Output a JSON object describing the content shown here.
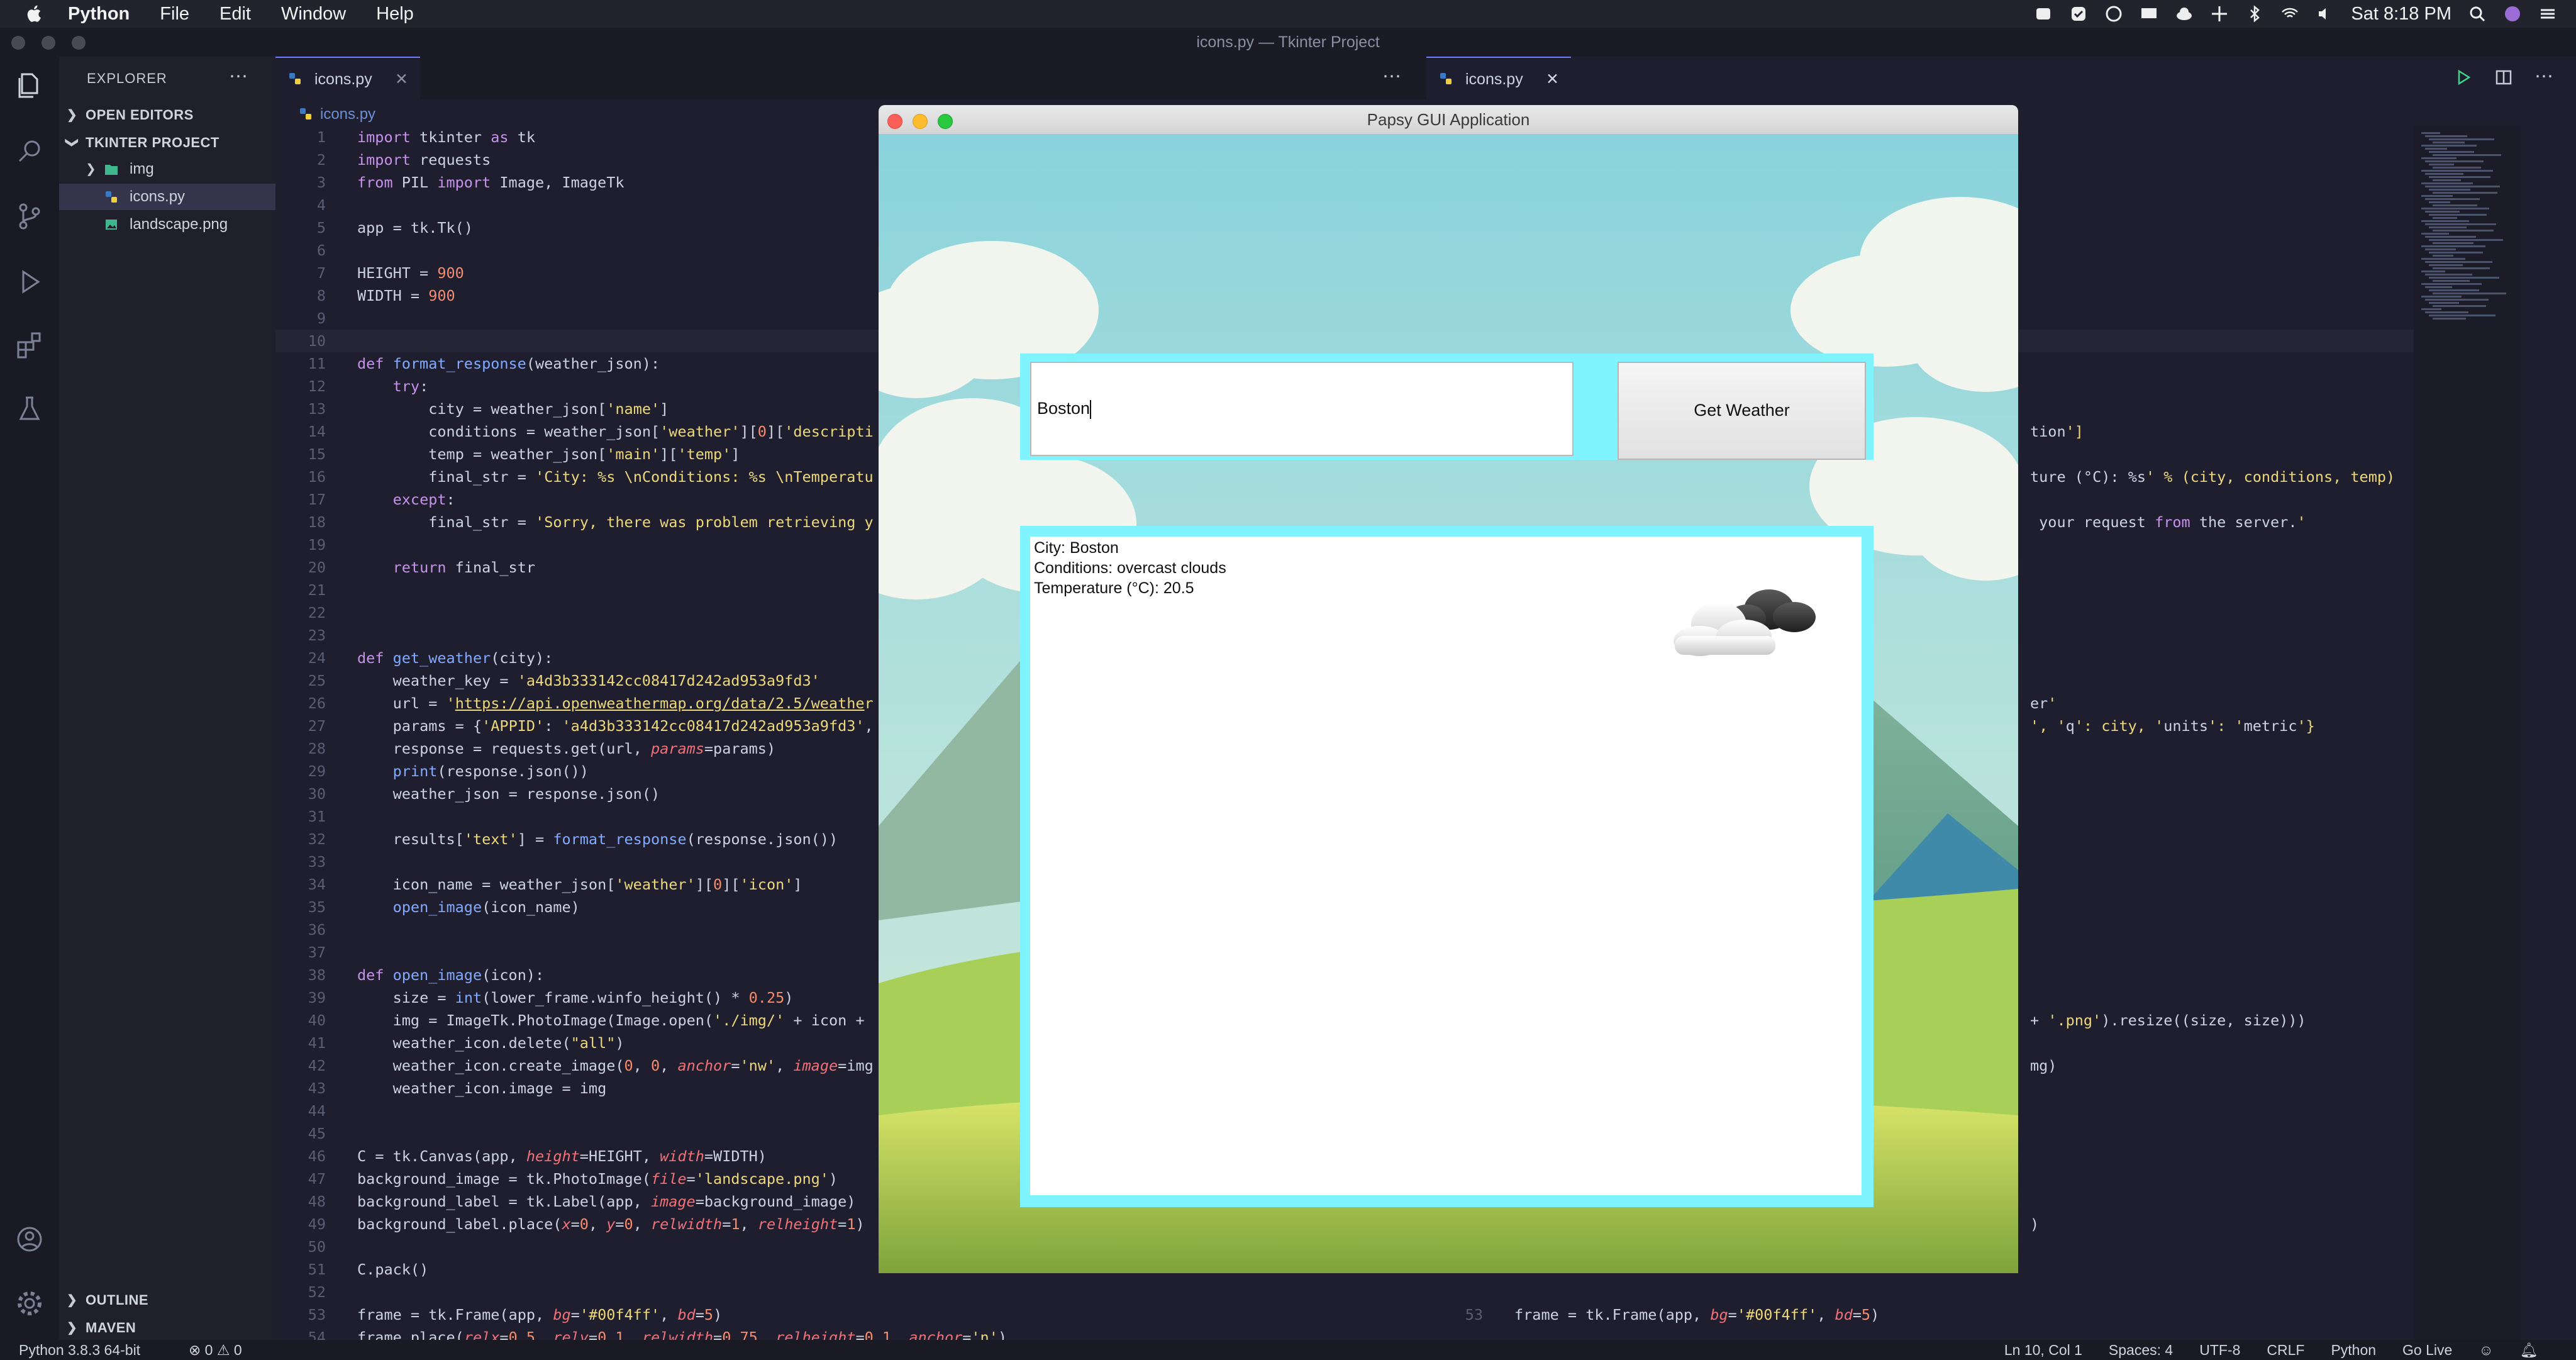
{
  "menubar": {
    "app": "Python",
    "items": [
      "File",
      "Edit",
      "Window",
      "Help"
    ],
    "clock": "Sat 8:18 PM"
  },
  "window_title": "icons.py — Tkinter Project",
  "sidebar": {
    "header": "EXPLORER",
    "open_editors": "OPEN EDITORS",
    "project": "TKINTER PROJECT",
    "files": [
      "img",
      "icons.py",
      "landscape.png"
    ],
    "outline": "OUTLINE",
    "maven": "MAVEN"
  },
  "editor": {
    "tab_left": "icons.py",
    "tab_right": "icons.py",
    "breadcrumb": "icons.py"
  },
  "code_lines": [
    "import tkinter as tk",
    "import requests",
    "from PIL import Image, ImageTk",
    "",
    "app = tk.Tk()",
    "",
    "HEIGHT = 900",
    "WIDTH = 900",
    "",
    "",
    "def format_response(weather_json):",
    "    try:",
    "        city = weather_json['name']",
    "        conditions = weather_json['weather'][0]['descripti",
    "        temp = weather_json['main']['temp']",
    "        final_str = 'City: %s \\nConditions: %s \\nTemperatu",
    "    except:",
    "        final_str = 'Sorry, there was problem retrieving y",
    "",
    "    return final_str",
    "",
    "",
    "",
    "def get_weather(city):",
    "    weather_key = 'a4d3b333142cc08417d242ad953a9fd3'",
    "    url = 'https://api.openweathermap.org/data/2.5/weather",
    "    params = {'APPID': 'a4d3b333142cc08417d242ad953a9fd3',",
    "    response = requests.get(url, params=params)",
    "    print(response.json())",
    "    weather_json = response.json()",
    "",
    "    results['text'] = format_response(response.json())",
    "",
    "    icon_name = weather_json['weather'][0]['icon']",
    "    open_image(icon_name)",
    "",
    "",
    "def open_image(icon):",
    "    size = int(lower_frame.winfo_height() * 0.25)",
    "    img = ImageTk.PhotoImage(Image.open('./img/' + icon +",
    "    weather_icon.delete(\"all\")",
    "    weather_icon.create_image(0, 0, anchor='nw', image=img",
    "    weather_icon.image = img",
    "",
    "",
    "C = tk.Canvas(app, height=HEIGHT, width=WIDTH)",
    "background_image = tk.PhotoImage(file='landscape.png')",
    "background_label = tk.Label(app, image=background_image)",
    "background_label.place(x=0, y=0, relwidth=1, relheight=1)",
    "",
    "C.pack()",
    "",
    "frame = tk.Frame(app, bg='#00f4ff', bd=5)",
    "frame.place(relx=0.5, rely=0.1, relwidth=0.75, relheight=0.1, anchor='n')"
  ],
  "code_right": [
    {
      "n": 14,
      "t": "tion']"
    },
    {
      "n": 16,
      "t": "ture (°C): %s' % (city, conditions, temp)"
    },
    {
      "n": 18,
      "t": " your request from the server.'"
    },
    {
      "n": 26,
      "t": "er'"
    },
    {
      "n": 27,
      "t": "', 'q': city, 'units': 'metric'}"
    },
    {
      "n": 40,
      "t": "+ '.png').resize((size, size)))"
    },
    {
      "n": 42,
      "t": "mg)"
    },
    {
      "n": 49,
      "t": ")"
    },
    {
      "n": 53,
      "t": "frame = tk.Frame(app, bg='#00f4ff', bd=5)"
    }
  ],
  "tk_app": {
    "title": "Papsy GUI Application",
    "entry_value": "Boston",
    "button_label": "Get Weather",
    "results": [
      "City: Boston",
      "Conditions: overcast clouds",
      "Temperature (°C): 20.5"
    ]
  },
  "status": {
    "python": "Python 3.8.3 64-bit",
    "problems": "⊗ 0 ⚠ 0",
    "items": [
      "Ln 10, Col 1",
      "Spaces: 4",
      "UTF-8",
      "CRLF",
      "Python",
      "Go Live"
    ]
  }
}
